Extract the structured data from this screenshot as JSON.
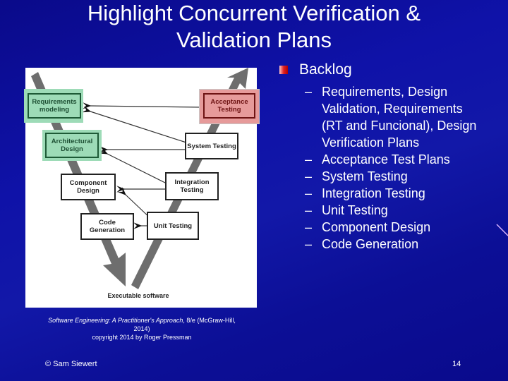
{
  "slide": {
    "title_lines": [
      "Highlight Concurrent Verification &",
      "Validation Plans"
    ],
    "background_color": "#0f12a8",
    "accent_color": "#e02020"
  },
  "figure": {
    "boxes": {
      "requirements_modeling": "Requirements modeling",
      "architectural_design": "Architectural Design",
      "component_design": "Component Design",
      "code_generation": "Code Generation",
      "acceptance_testing": "Acceptance Testing",
      "system_testing": "System Testing",
      "integration_testing": "Integration Testing",
      "unit_testing": "Unit Testing"
    },
    "bottom_label": "Executable software",
    "highlight_green": "#9ddbb7",
    "highlight_red": "#e69a9a"
  },
  "caption": {
    "book_title": "Software Engineering: A Practitioner's Approach",
    "edition_publisher": ", 8/e (McGraw-Hill, 2014)",
    "copyright": "copyright 2014 by Roger Pressman"
  },
  "bullets": {
    "heading": "Backlog",
    "items": [
      "Requirements, Design Validation, Requirements (RT and Funcional), Design Verification Plans",
      "Acceptance Test Plans",
      "System Testing",
      "Integration Testing",
      "Unit Testing",
      "Component Design",
      "Code Generation"
    ],
    "dash": "–"
  },
  "footer": {
    "author": "© Sam Siewert",
    "page_number": "14"
  }
}
